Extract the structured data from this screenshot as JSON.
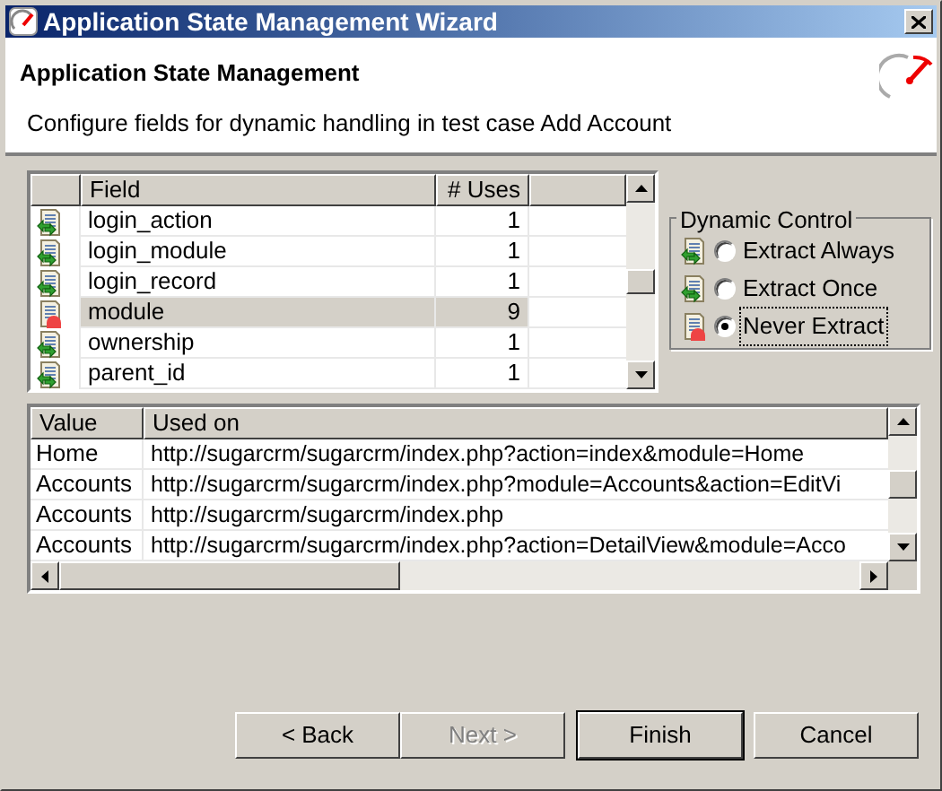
{
  "window": {
    "title": "Application State Management Wizard"
  },
  "header": {
    "title": "Application State Management",
    "description": "Configure fields for dynamic handling in test case Add Account"
  },
  "fields_table": {
    "columns": [
      "Field",
      "# Uses"
    ],
    "rows": [
      {
        "kind": "extract",
        "field": "login_action",
        "uses": "1",
        "selected": false
      },
      {
        "kind": "extract",
        "field": "login_module",
        "uses": "1",
        "selected": false
      },
      {
        "kind": "extract",
        "field": "login_record",
        "uses": "1",
        "selected": false
      },
      {
        "kind": "never",
        "field": "module",
        "uses": "9",
        "selected": true
      },
      {
        "kind": "extract",
        "field": "ownership",
        "uses": "1",
        "selected": false
      },
      {
        "kind": "extract",
        "field": "parent_id",
        "uses": "1",
        "selected": false
      }
    ]
  },
  "dynamic_control": {
    "title": "Dynamic Control",
    "options": [
      {
        "kind": "extract",
        "label": "Extract Always",
        "selected": false
      },
      {
        "kind": "extract",
        "label": "Extract Once",
        "selected": false
      },
      {
        "kind": "never",
        "label": "Never Extract",
        "selected": true
      }
    ]
  },
  "values_table": {
    "columns": [
      "Value",
      "Used on"
    ],
    "rows": [
      {
        "value": "Home",
        "used_on": "http://sugarcrm/sugarcrm/index.php?action=index&module=Home"
      },
      {
        "value": "Accounts",
        "used_on": "http://sugarcrm/sugarcrm/index.php?module=Accounts&action=EditVi"
      },
      {
        "value": "Accounts",
        "used_on": "http://sugarcrm/sugarcrm/index.php"
      },
      {
        "value": "Accounts",
        "used_on": "http://sugarcrm/sugarcrm/index.php?action=DetailView&module=Acco"
      }
    ]
  },
  "buttons": [
    {
      "label": "< Back",
      "disabled": false,
      "default": false
    },
    {
      "label": "Next >",
      "disabled": true,
      "default": false
    },
    {
      "label": "Finish",
      "disabled": false,
      "default": true
    },
    {
      "label": "Cancel",
      "disabled": false,
      "default": false
    }
  ]
}
